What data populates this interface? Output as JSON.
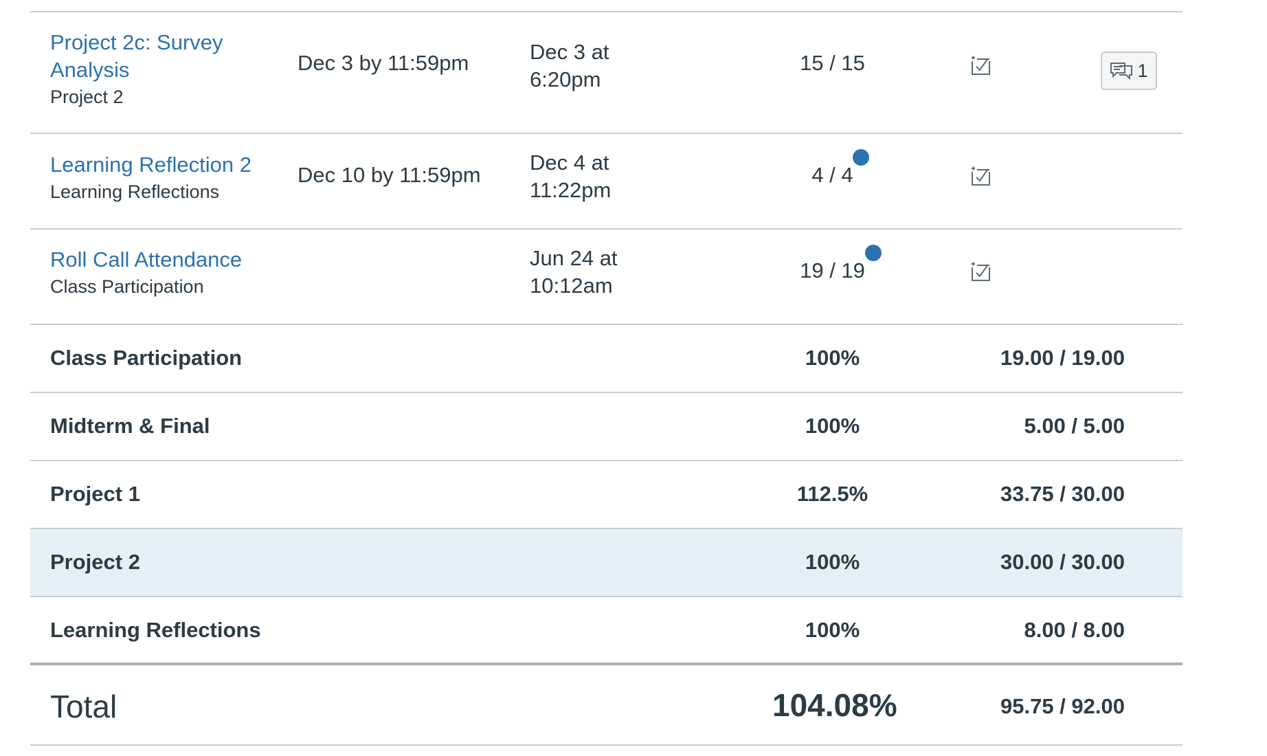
{
  "assignments": [
    {
      "name": "Project 2c: Survey Analysis",
      "group": "Project 2",
      "due": "Dec 3 by 11:59pm",
      "submitted": "Dec 3 at 6:20pm",
      "score": "15 / 15",
      "unread": false,
      "comments": "1"
    },
    {
      "name": "Learning Reflection 2",
      "group": "Learning Reflections",
      "due": "Dec 10 by 11:59pm",
      "submitted": "Dec 4 at 11:22pm",
      "score": "4 / 4",
      "unread": true
    },
    {
      "name": "Roll Call Attendance",
      "group": "Class Participation",
      "due": "",
      "submitted": "Jun 24 at 10:12am",
      "score": "19 / 19",
      "unread": true
    }
  ],
  "groups": [
    {
      "name": "Class Participation",
      "percent": "100%",
      "points": "19.00 / 19.00"
    },
    {
      "name": "Midterm & Final",
      "percent": "100%",
      "points": "5.00 / 5.00"
    },
    {
      "name": "Project 1",
      "percent": "112.5%",
      "points": "33.75 / 30.00"
    },
    {
      "name": "Project 2",
      "percent": "100%",
      "points": "30.00 / 30.00"
    },
    {
      "name": "Learning Reflections",
      "percent": "100%",
      "points": "8.00 / 8.00"
    }
  ],
  "total": {
    "label": "Total",
    "percent": "104.08%",
    "points": "95.75 / 92.00"
  },
  "icons": {
    "rubric": "rubric-icon",
    "comment": "comment-icon",
    "unread": "unread-dot"
  },
  "colors": {
    "link": "#2b72b0",
    "text": "#2d3b45",
    "highlight": "#e5f0f5",
    "border": "#c7cdd1"
  }
}
